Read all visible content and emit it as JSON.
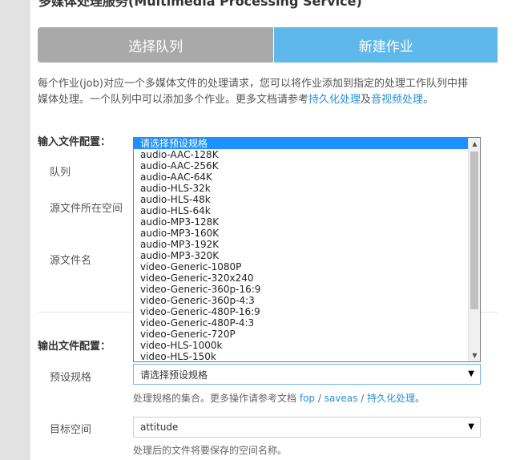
{
  "page": {
    "title": "多媒体处理服务(Multimedia Processing Service)"
  },
  "tabs": [
    {
      "label": "选择队列"
    },
    {
      "label": "新建作业"
    }
  ],
  "intro": {
    "line1": "每个作业(job)对应一个多媒体文件的处理请求，您可以将作业添加到指定的处理工作队列中排",
    "line2_prefix": "媒体处理。一个队列中可以添加多个作业。更多文档请参考",
    "link1": "持久化处理",
    "and": "及",
    "link2": "音视频处理",
    "line2_suffix": "。"
  },
  "input_section": {
    "title": "输入文件配置：",
    "queue_label": "队列",
    "bucket_label": "源文件所在空间",
    "filename_label": "源文件名"
  },
  "dropdown": {
    "options": [
      "请选择预设规格",
      "audio-AAC-128K",
      "audio-AAC-256K",
      "audio-AAC-64K",
      "audio-HLS-32k",
      "audio-HLS-48k",
      "audio-HLS-64k",
      "audio-MP3-128K",
      "audio-MP3-160K",
      "audio-MP3-192K",
      "audio-MP3-320K",
      "video-Generic-1080P",
      "video-Generic-320x240",
      "video-Generic-360p-16:9",
      "video-Generic-360p-4:3",
      "video-Generic-480P-16:9",
      "video-Generic-480P-4:3",
      "video-Generic-720P",
      "video-HLS-1000k",
      "video-HLS-150k"
    ],
    "scroll_up": "▲",
    "scroll_down": "▼"
  },
  "output_section": {
    "title": "输出文件配置：",
    "preset_label": "预设规格",
    "preset_value": "请选择预设规格",
    "preset_help_prefix": "处理规格的集合。更多操作请参考文档",
    "preset_help_link1": "fop",
    "preset_help_sep1": " / ",
    "preset_help_link2": "saveas",
    "preset_help_sep2": " / ",
    "preset_help_link3": "持久化处理",
    "preset_help_suffix": "。",
    "target_label": "目标空间",
    "target_value": "attitude",
    "target_help": "处理后的文件将要保存的空间名称。"
  },
  "icons": {
    "select_arrow": "▼"
  },
  "colors": {
    "tab_inactive": "#a9a9a9",
    "tab_active": "#5fb8ea",
    "link": "#2a8fd6",
    "option_highlight": "#1e90ff"
  }
}
